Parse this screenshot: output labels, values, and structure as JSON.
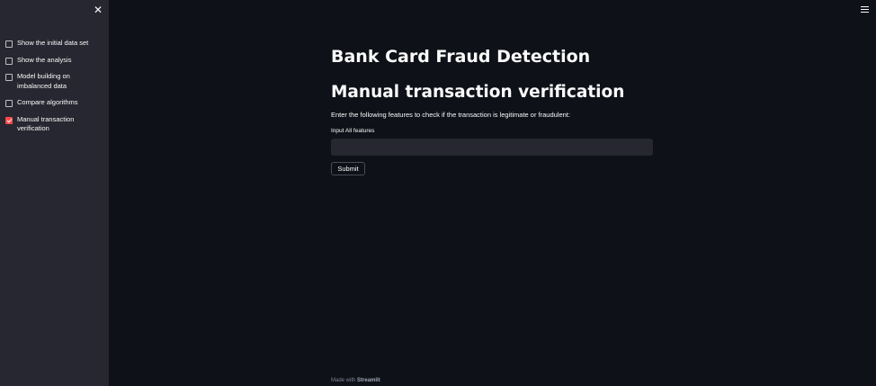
{
  "sidebar": {
    "close_icon": "close-icon",
    "checkboxes": [
      {
        "label": "Show the initial data set",
        "checked": false
      },
      {
        "label": "Show the analysis",
        "checked": false
      },
      {
        "label": "Model building on imbalanced data",
        "checked": false
      },
      {
        "label": "Compare algorithms",
        "checked": false
      },
      {
        "label": "Manual transaction verification",
        "checked": true
      }
    ]
  },
  "header": {
    "menu_icon": "hamburger-menu-icon"
  },
  "main": {
    "title": "Bank Card Fraud Detection",
    "subtitle": "Manual transaction verification",
    "description": "Enter the following features to check if the transaction is legitimate or fraudulent:",
    "input_label": "Input All features",
    "input_value": "",
    "submit_label": "Submit"
  },
  "footer": {
    "prefix": "Made with",
    "brand": "Streamlit"
  },
  "colors": {
    "accent": "#ff4b4b",
    "background": "#0e1117",
    "sidebar": "#262730"
  }
}
